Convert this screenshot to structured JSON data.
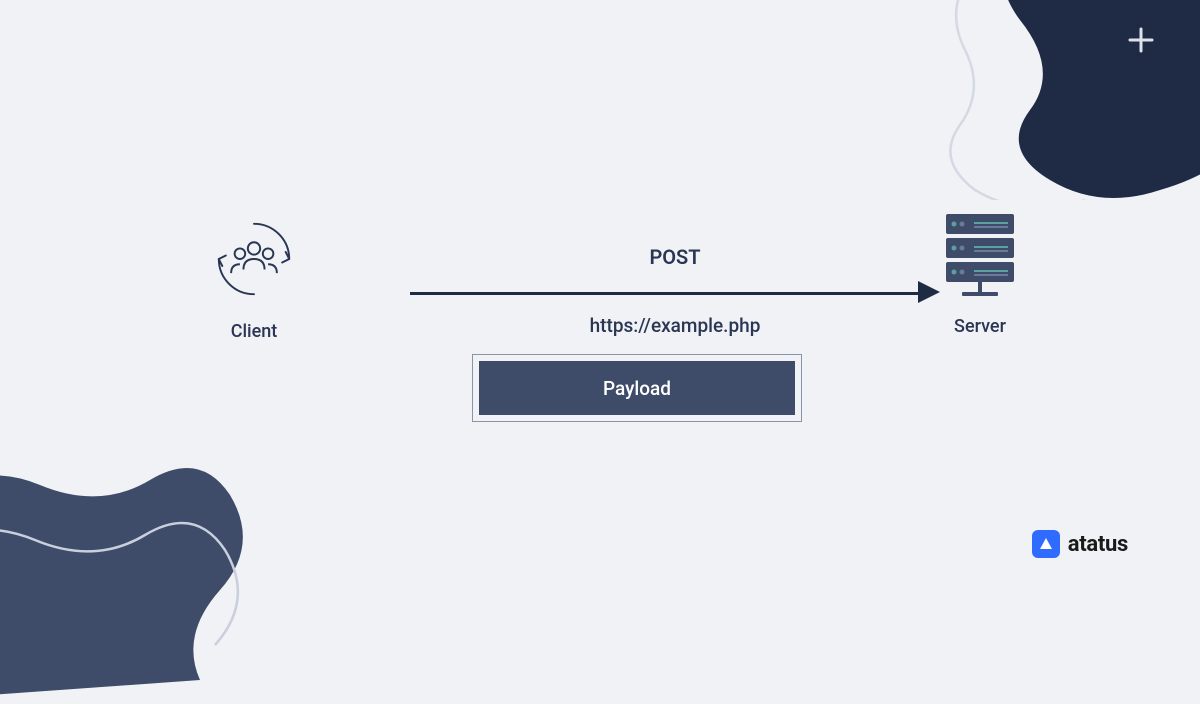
{
  "diagram": {
    "client_label": "Client",
    "server_label": "Server",
    "method": "POST",
    "url": "https://example.php",
    "payload_label": "Payload"
  },
  "brand": {
    "name": "atatus"
  },
  "colors": {
    "dark_navy": "#1f2a44",
    "payload_bg": "#3e4c6a",
    "icon_stroke": "#2a3654",
    "line_light": "#c9cfdd",
    "brand_blue": "#2f6bff"
  }
}
